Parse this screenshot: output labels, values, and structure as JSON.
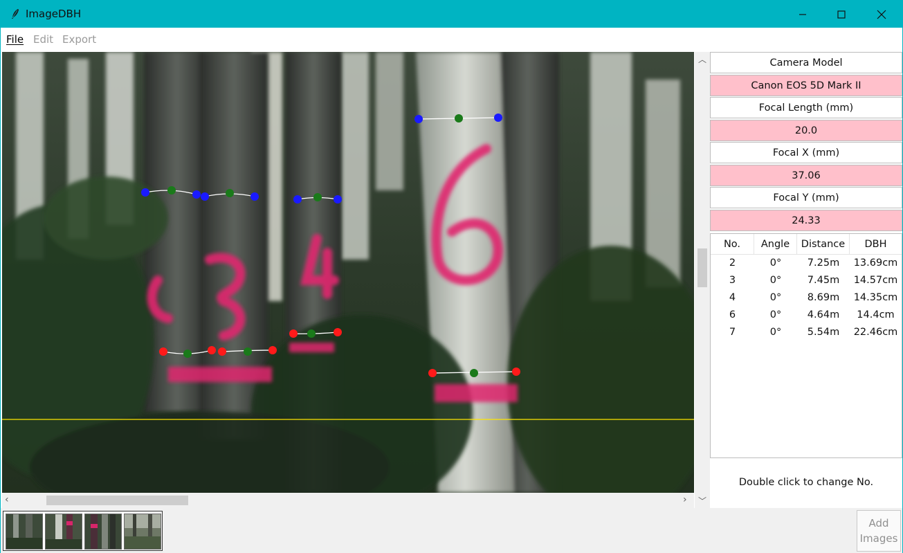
{
  "window": {
    "title": "ImageDBH",
    "accent_color": "#00b4c2"
  },
  "menu": {
    "file": "File",
    "edit": "Edit",
    "export": "Export"
  },
  "panel": {
    "camera_model_label": "Camera Model",
    "camera_model_value": "Canon EOS 5D Mark II",
    "focal_length_label": "Focal Length (mm)",
    "focal_length_value": "20.0",
    "focal_x_label": "Focal X (mm)",
    "focal_x_value": "37.06",
    "focal_y_label": "Focal Y (mm)",
    "focal_y_value": "24.33",
    "value_bg_color": "#ffc0cb"
  },
  "table": {
    "headers": [
      "No.",
      "Angle",
      "Distance",
      "DBH"
    ],
    "rows": [
      [
        "2",
        "0°",
        "7.25m",
        "13.69cm"
      ],
      [
        "3",
        "0°",
        "7.45m",
        "14.57cm"
      ],
      [
        "4",
        "0°",
        "8.69m",
        "14.35cm"
      ],
      [
        "6",
        "0°",
        "4.64m",
        "14.4cm"
      ],
      [
        "7",
        "0°",
        "5.54m",
        "22.46cm"
      ]
    ]
  },
  "hint": "Double click to change No.",
  "add_button": {
    "line1": "Add",
    "line2": "Images"
  },
  "icons": {
    "app": "feather-icon",
    "minimize": "minimize-icon",
    "maximize": "maximize-icon",
    "close": "close-icon"
  },
  "marker_colors": {
    "top": "#1a1aff",
    "bottom": "#ff1a1a",
    "center": "#1a7a1a",
    "reference_line": "#ffe600"
  }
}
